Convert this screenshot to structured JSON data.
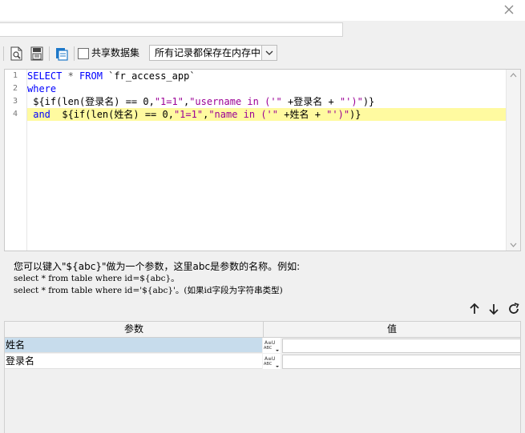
{
  "window": {
    "close_icon": "close-icon"
  },
  "toolbar": {
    "icons": [
      "preview-icon",
      "save-icon",
      "query-icon"
    ],
    "share_dataset_label": "共享数据集",
    "share_dataset_checked": false,
    "storage_option": "所有记录都保存在内存中"
  },
  "editor": {
    "line_numbers": [
      "1",
      "2",
      "3",
      "4"
    ],
    "line1": {
      "kw1": "SELECT",
      "star": " * ",
      "kw2": "FROM",
      "rest": " `fr_access_app`"
    },
    "line2": {
      "kw": "where"
    },
    "line3": {
      "a": " ${if(len(登录名) == 0,",
      "s1": "\"1=1\"",
      "b": ",",
      "s2": "\"username in ('\"",
      "c": " +登录名 + ",
      "s3": "\"')\"",
      "d": ")}"
    },
    "line4": {
      "kw": " and",
      "a": "  ${if(len(姓名) == 0,",
      "s1": "\"1=1\"",
      "b": ",",
      "s2": "\"name in ('\"",
      "c": " +姓名 + ",
      "s3": "\"')\"",
      "d": ")}"
    }
  },
  "hint": {
    "line1": "您可以键入\"${abc}\"做为一个参数，这里abc是参数的名称。例如:",
    "line2": "select * from table where id=${abc}。",
    "line3": "select * from table where id='${abc}'。(如果id字段为字符串类型)"
  },
  "param_actions": [
    "arrow-up-icon",
    "arrow-down-icon",
    "refresh-icon"
  ],
  "param_table": {
    "headers": {
      "name": "参数",
      "value": "值"
    },
    "rows": [
      {
        "name": "姓名",
        "value": "",
        "selected": true
      },
      {
        "name": "登录名",
        "value": "",
        "selected": false
      }
    ]
  }
}
